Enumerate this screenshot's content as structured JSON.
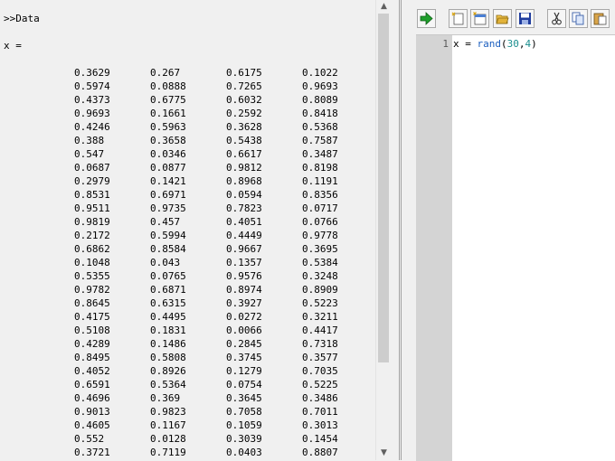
{
  "console": {
    "prompt": ">>Data",
    "var_line": "x =",
    "rows": [
      [
        "0.3629",
        "0.267",
        "0.6175",
        "0.1022"
      ],
      [
        "0.5974",
        "0.0888",
        "0.7265",
        "0.9693"
      ],
      [
        "0.4373",
        "0.6775",
        "0.6032",
        "0.8089"
      ],
      [
        "0.9693",
        "0.1661",
        "0.2592",
        "0.8418"
      ],
      [
        "0.4246",
        "0.5963",
        "0.3628",
        "0.5368"
      ],
      [
        "0.388",
        "0.3658",
        "0.5438",
        "0.7587"
      ],
      [
        "0.547",
        "0.0346",
        "0.6617",
        "0.3487"
      ],
      [
        "0.0687",
        "0.0877",
        "0.9812",
        "0.8198"
      ],
      [
        "0.2979",
        "0.1421",
        "0.8968",
        "0.1191"
      ],
      [
        "0.8531",
        "0.6971",
        "0.0594",
        "0.8356"
      ],
      [
        "0.9511",
        "0.9735",
        "0.7823",
        "0.0717"
      ],
      [
        "0.9819",
        "0.457",
        "0.4051",
        "0.0766"
      ],
      [
        "0.2172",
        "0.5994",
        "0.4449",
        "0.9778"
      ],
      [
        "0.6862",
        "0.8584",
        "0.9667",
        "0.3695"
      ],
      [
        "0.1048",
        "0.043",
        "0.1357",
        "0.5384"
      ],
      [
        "0.5355",
        "0.0765",
        "0.9576",
        "0.3248"
      ],
      [
        "0.9782",
        "0.6871",
        "0.8974",
        "0.8909"
      ],
      [
        "0.8645",
        "0.6315",
        "0.3927",
        "0.5223"
      ],
      [
        "0.4175",
        "0.4495",
        "0.0272",
        "0.3211"
      ],
      [
        "0.5108",
        "0.1831",
        "0.0066",
        "0.4417"
      ],
      [
        "0.4289",
        "0.1486",
        "0.2845",
        "0.7318"
      ],
      [
        "0.8495",
        "0.5808",
        "0.3745",
        "0.3577"
      ],
      [
        "0.4052",
        "0.8926",
        "0.1279",
        "0.7035"
      ],
      [
        "0.6591",
        "0.5364",
        "0.0754",
        "0.5225"
      ],
      [
        "0.4696",
        "0.369",
        "0.3645",
        "0.3486"
      ],
      [
        "0.9013",
        "0.9823",
        "0.7058",
        "0.7011"
      ],
      [
        "0.4605",
        "0.1167",
        "0.1059",
        "0.3013"
      ],
      [
        "0.552",
        "0.0128",
        "0.3039",
        "0.1454"
      ],
      [
        "0.3721",
        "0.7119",
        "0.0403",
        "0.8807"
      ]
    ]
  },
  "scrollbar": {
    "up_arrow": "▲",
    "down_arrow": "▼"
  },
  "toolbar": {
    "buttons": [
      {
        "icon": "run-arrow-icon",
        "color": "#1f9e2c"
      },
      {
        "icon": "new-file-icon"
      },
      {
        "icon": "new-window-icon"
      },
      {
        "icon": "open-folder-icon",
        "color": "#e2b33a"
      },
      {
        "icon": "save-disk-icon",
        "color": "#1f3c9e"
      },
      {
        "icon": "cut-scissors-icon"
      },
      {
        "icon": "copy-icon"
      },
      {
        "icon": "paste-icon"
      }
    ]
  },
  "editor": {
    "line_numbers": [
      "1"
    ],
    "code": {
      "var": "x",
      "op": " = ",
      "fn": "rand",
      "open": "(",
      "arg1": "30",
      "comma": ",",
      "arg2": "4",
      "close": ")"
    }
  }
}
